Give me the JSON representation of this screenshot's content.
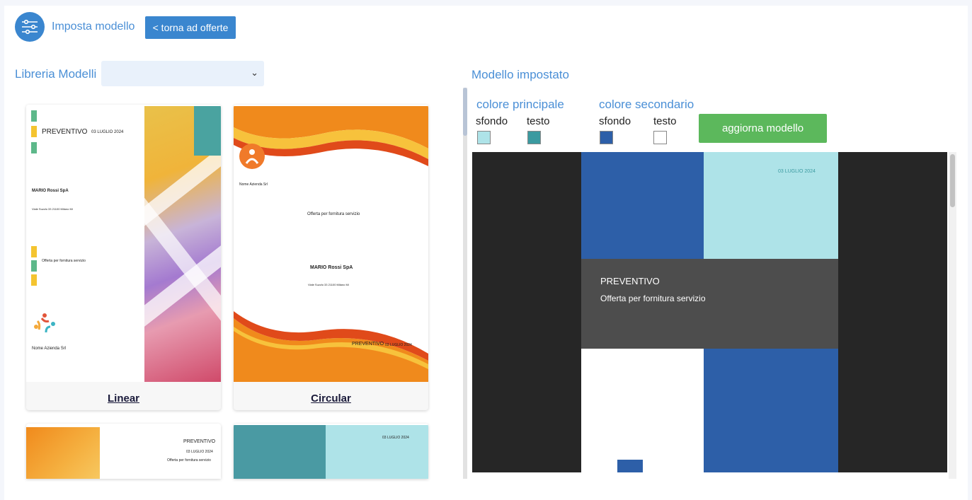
{
  "header": {
    "title": "Imposta modello",
    "back_button": "< torna ad offerte"
  },
  "library": {
    "label": "Libreria Modelli",
    "select_value": ""
  },
  "templates": [
    {
      "name": "Linear",
      "doc_title": "PREVENTIVO",
      "date": "03 LUGLIO 2024",
      "client": "MARIO Rossi SpA",
      "address": "Viale Suzzlo 33 21100 Milano Mi",
      "subject": "Offerta per fornitura servizio",
      "company": "Nome Azienda Srl"
    },
    {
      "name": "Circular",
      "company": "Nome Azienda Srl",
      "subject": "Offerta per fornitura servizio",
      "client": "MARIO Rossi SpA",
      "address": "Viale Suzzlo 33 21100 Milano Mi",
      "doc_title": "PREVENTIVO",
      "date": "03 LUGLIO 2024"
    },
    {
      "doc_title": "PREVENTIVO",
      "date": "03 LUGLIO 2024",
      "subject": "Offerta per fornitura servizio"
    },
    {
      "date": "03 LUGLIO 2024"
    }
  ],
  "model": {
    "label": "Modello impostato",
    "primary_label": "colore principale",
    "secondary_label": "colore secondario",
    "bg_label": "sfondo",
    "text_label": "testo",
    "update_button": "aggiorna modello",
    "colors": {
      "primary_bg": "#aee3e8",
      "primary_text": "#3b9aa0",
      "secondary_bg": "#2d5fa8",
      "secondary_text": "#ffffff"
    }
  },
  "preview": {
    "date": "03 LUGLIO 2024",
    "doc_title": "PREVENTIVO",
    "subject": "Offerta per fornitura servizio"
  }
}
